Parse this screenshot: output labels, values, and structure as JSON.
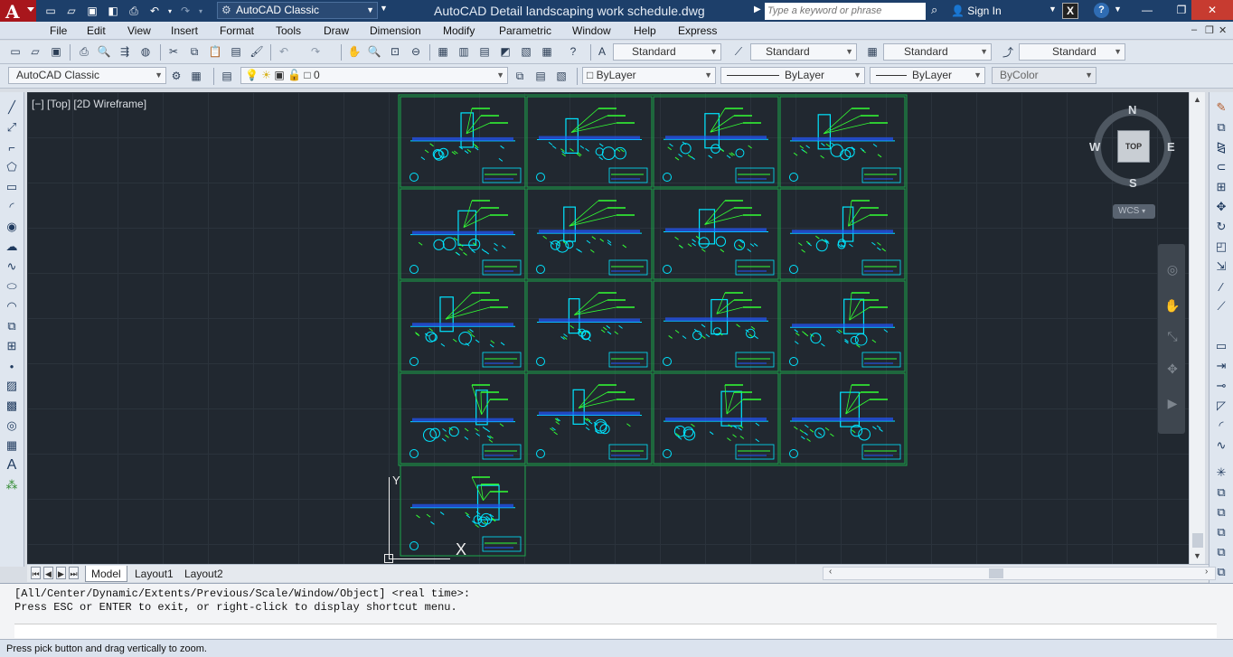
{
  "title_bar": {
    "workspace": "AutoCAD Classic",
    "window_title": "AutoCAD Detail landscaping work schedule.dwg",
    "search_placeholder": "Type a keyword or phrase",
    "sign_in": "Sign In"
  },
  "menu": [
    "File",
    "Edit",
    "View",
    "Insert",
    "Format",
    "Tools",
    "Draw",
    "Dimension",
    "Modify",
    "Parametric",
    "Window",
    "Help",
    "Express"
  ],
  "styles_toolbar": {
    "text_style": "Standard",
    "dim_style": "Standard",
    "table_style": "Standard",
    "mleader_style": "Standard"
  },
  "layers_toolbar": {
    "workspace": "AutoCAD Classic",
    "current_layer": "0"
  },
  "properties_toolbar": {
    "color": "ByLayer",
    "linetype": "ByLayer",
    "lineweight": "ByLayer",
    "plot_style": "ByColor"
  },
  "viewport": {
    "label": "[−] [Top] [2D Wireframe]",
    "sheet_count": 17
  },
  "viewcube": {
    "north": "N",
    "south": "S",
    "east": "E",
    "west": "W",
    "face": "TOP",
    "ucs": "WCS"
  },
  "tabs": [
    "Model",
    "Layout1",
    "Layout2"
  ],
  "command": {
    "line1": "[All/Center/Dynamic/Extents/Previous/Scale/Window/Object] <real time>:",
    "line2": "Press ESC or ENTER to exit, or right-click to display shortcut menu."
  },
  "status": "Press pick button and drag vertically to zoom.",
  "colors": {
    "titlebar": "#1d3f6a",
    "canvas": "#212830",
    "sheet_border": "#1ba64a",
    "drawing_cyan": "#00e5ff",
    "drawing_green": "#33ff33",
    "drawing_blue": "#2255ff"
  }
}
